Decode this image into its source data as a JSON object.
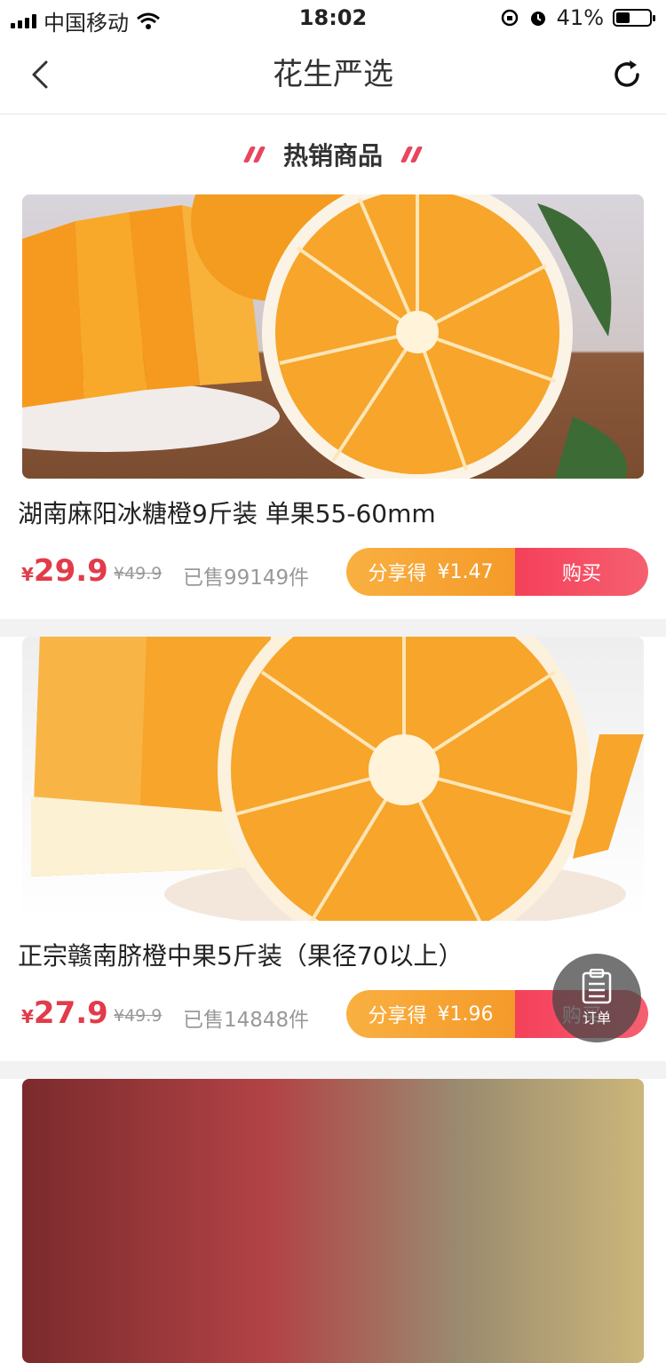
{
  "status_bar": {
    "carrier": "中国移动",
    "time": "18:02",
    "battery": "41%",
    "battery_level": 0.41
  },
  "nav": {
    "title": "花生严选"
  },
  "section": {
    "title": "热销商品"
  },
  "products": [
    {
      "name": "湖南麻阳冰糖橙9斤装 单果55-60mm",
      "currency": "¥",
      "price": "29.9",
      "original_price": "¥49.9",
      "sold": "已售99149件",
      "share_label": "分享得",
      "share_amount": "¥1.47",
      "buy_label": "购买"
    },
    {
      "name": "正宗赣南脐橙中果5斤装（果径70以上）",
      "currency": "¥",
      "price": "27.9",
      "original_price": "¥49.9",
      "sold": "已售14848件",
      "share_label": "分享得",
      "share_amount": "¥1.96",
      "buy_label": "购买"
    }
  ],
  "fab": {
    "label": "订单",
    "icon": "clipboard-icon"
  }
}
